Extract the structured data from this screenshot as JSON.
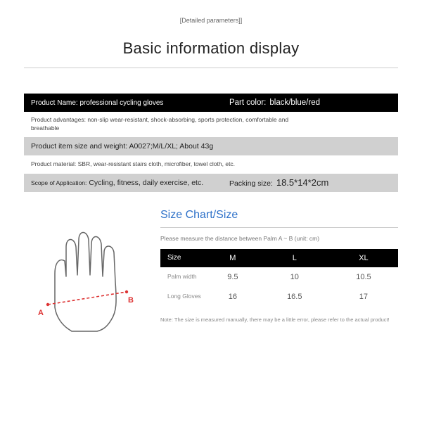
{
  "header": {
    "topnote": "[Detailed parameters]]",
    "title": "Basic information display"
  },
  "info": {
    "name_label": "Product Name: professional cycling gloves",
    "color_label": "Part color:",
    "color_value": "black/blue/red",
    "advantages": "Product advantages: non-slip wear-resistant, shock-absorbing, sports protection, comfortable and breathable",
    "item_size_weight": "Product item size and weight: A0027;M/L/XL; About 43g",
    "material": "Product material: SBR, wear-resistant stairs cloth, microfiber, towel cloth, etc.",
    "scope_label": "Scope of Application:",
    "scope_value": "Cycling, fitness, daily exercise, etc.",
    "packing_label": "Packing size:",
    "packing_value": "18.5*14*2cm"
  },
  "markers": {
    "A": "A",
    "B": "B"
  },
  "chart": {
    "title": "Size Chart/Size",
    "subtitle": "Please measure the distance between Palm A ~ B (unit: cm)"
  },
  "chart_data": {
    "type": "table",
    "title": "Size Chart/Size",
    "columns": [
      "Size",
      "M",
      "L",
      "XL"
    ],
    "rows": [
      {
        "label": "Palm width",
        "values": [
          "9.5",
          "10",
          "10.5"
        ]
      },
      {
        "label": "Long Gloves",
        "values": [
          "16",
          "16.5",
          "17"
        ]
      }
    ],
    "unit": "cm"
  },
  "footnote": "Note: The size is measured manually, there may be a little error, please refer to the actual product!"
}
